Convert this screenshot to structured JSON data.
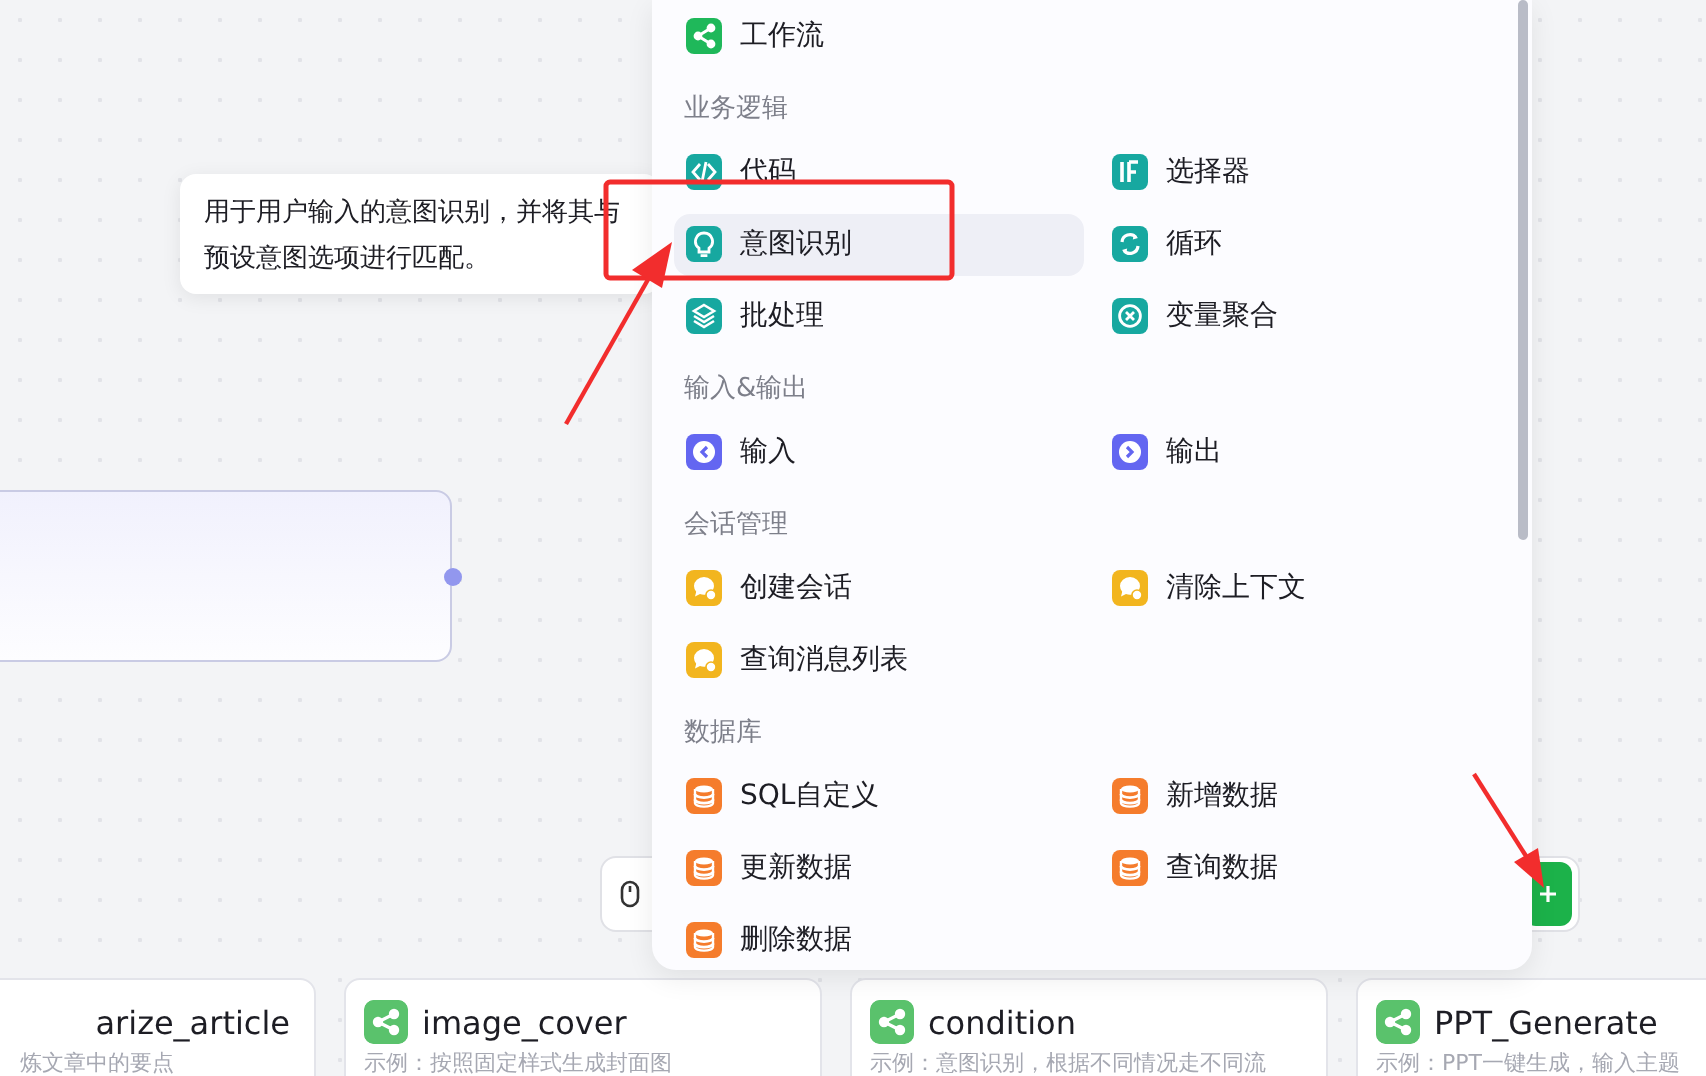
{
  "tooltip": {
    "text": "用于用户输入的意图识别，并将其与预设意图选项进行匹配。"
  },
  "node_menu": {
    "sections": [
      {
        "items": [
          {
            "label": "工作流",
            "color": "#1fb85a",
            "selected": false
          }
        ]
      },
      {
        "title": "业务逻辑",
        "items": [
          {
            "label": "代码",
            "color": "#17a8a0",
            "selected": false
          },
          {
            "label": "选择器",
            "color": "#17a8a0",
            "selected": false
          },
          {
            "label": "意图识别",
            "color": "#17a8a0",
            "selected": true
          },
          {
            "label": "循环",
            "color": "#17a8a0",
            "selected": false
          },
          {
            "label": "批处理",
            "color": "#17a8a0",
            "selected": false
          },
          {
            "label": "变量聚合",
            "color": "#17a8a0",
            "selected": false
          }
        ]
      },
      {
        "title": "输入&输出",
        "items": [
          {
            "label": "输入",
            "color": "#6366f1",
            "selected": false
          },
          {
            "label": "输出",
            "color": "#6366f1",
            "selected": false
          }
        ]
      },
      {
        "title": "会话管理",
        "items": [
          {
            "label": "创建会话",
            "color": "#f2b51f",
            "selected": false
          },
          {
            "label": "清除上下文",
            "color": "#f2b51f",
            "selected": false
          },
          {
            "label": "查询消息列表",
            "color": "#f2b51f",
            "selected": false
          }
        ]
      },
      {
        "title": "数据库",
        "items": [
          {
            "label": "SQL自定义",
            "color": "#f57c2c",
            "selected": false
          },
          {
            "label": "新增数据",
            "color": "#f57c2c",
            "selected": false
          },
          {
            "label": "更新数据",
            "color": "#f57c2c",
            "selected": false
          },
          {
            "label": "查询数据",
            "color": "#f57c2c",
            "selected": false
          },
          {
            "label": "删除数据",
            "color": "#f57c2c",
            "selected": false
          }
        ]
      }
    ]
  },
  "template_cards": [
    {
      "title": "arize_article",
      "description": "炼文章中的要点"
    },
    {
      "title": "image_cover",
      "description": "示例：按照固定样式生成封面图"
    },
    {
      "title": "condition",
      "description": "示例：意图识别，根据不同情况走不同流"
    },
    {
      "title": "PPT_Generate",
      "description": "示例：PPT一键生成，输入主题"
    }
  ]
}
